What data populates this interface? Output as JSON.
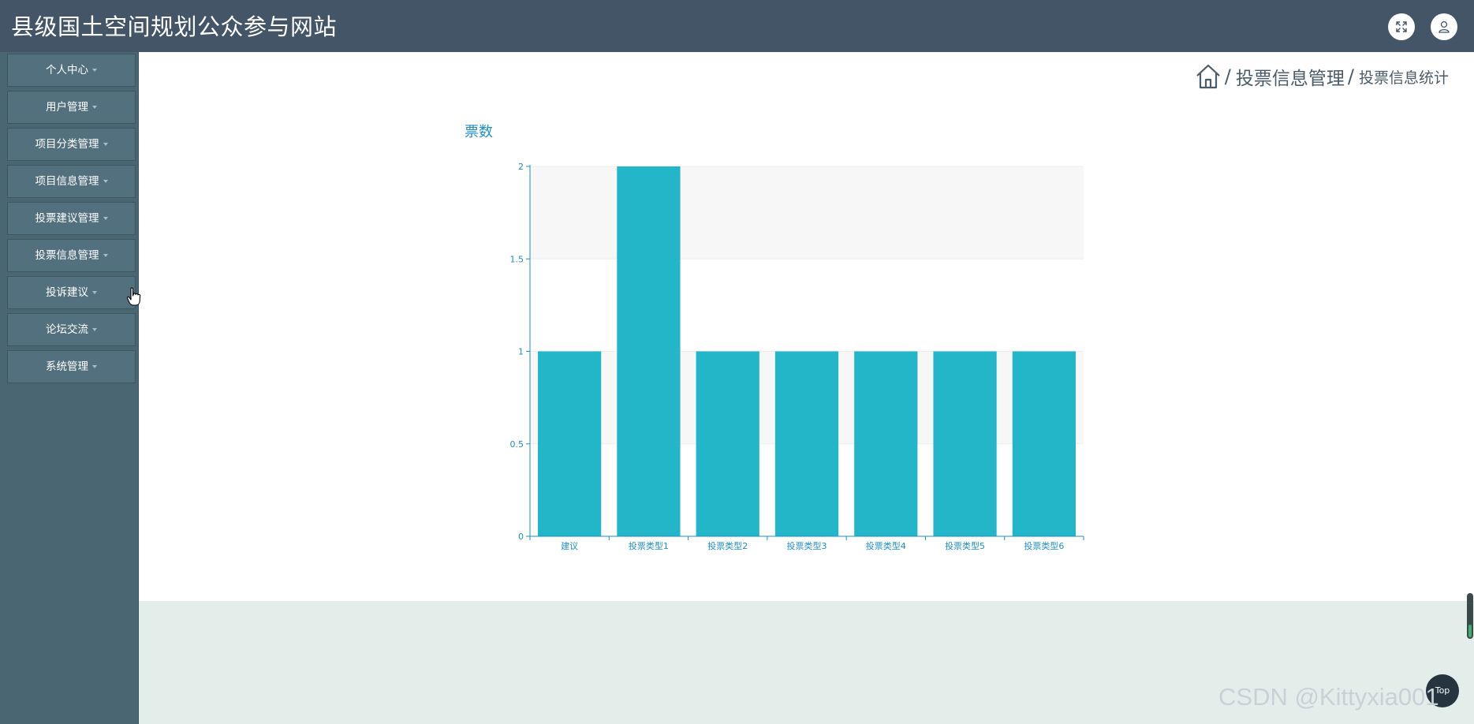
{
  "header": {
    "title": "县级国土空间规划公众参与网站",
    "fullscreen_icon": "fullscreen-icon",
    "user_icon": "user-icon"
  },
  "sidebar": {
    "items": [
      {
        "label": "个人中心"
      },
      {
        "label": "用户管理"
      },
      {
        "label": "项目分类管理"
      },
      {
        "label": "项目信息管理"
      },
      {
        "label": "投票建议管理"
      },
      {
        "label": "投票信息管理"
      },
      {
        "label": "投诉建议"
      },
      {
        "label": "论坛交流"
      },
      {
        "label": "系统管理"
      }
    ]
  },
  "breadcrumb": {
    "home_icon": "home-icon",
    "separator": "/",
    "section": "投票信息管理",
    "current": "投票信息统计"
  },
  "chart_data": {
    "type": "bar",
    "ylabel": "票数",
    "categories": [
      "建议",
      "投票类型1",
      "投票类型2",
      "投票类型3",
      "投票类型4",
      "投票类型5",
      "投票类型6"
    ],
    "values": [
      1,
      2,
      1,
      1,
      1,
      1,
      1
    ],
    "ylim": [
      0,
      2
    ],
    "yticks": [
      "0",
      "0.5",
      "1",
      "1.5",
      "2"
    ],
    "bar_color": "#22b6c8",
    "axis_color": "#1e8fc9",
    "band_color": "#f7f7f7"
  },
  "footer": {
    "top_button": "Top",
    "watermark": "CSDN @Kittyxia001"
  },
  "colors": {
    "header_bg": "#435566",
    "sidebar_bg": "#4b6673",
    "footer_bg": "#e3eeeb"
  }
}
